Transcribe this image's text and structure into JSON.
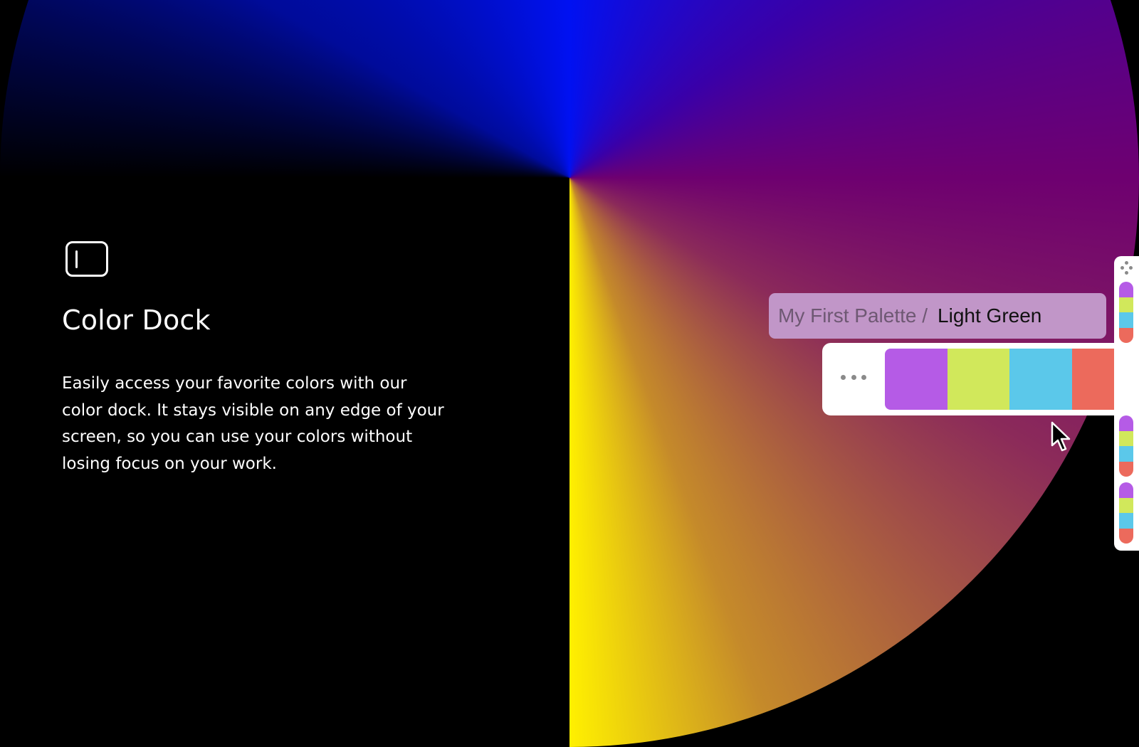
{
  "feature": {
    "icon": "dock-sidebar-icon",
    "title": "Color Dock",
    "description": "Easily access your favorite colors with our color dock. It stays visible on any edge of your screen, so you can use your colors without losing focus on your work."
  },
  "dock": {
    "palette_label": "My First Palette /",
    "color_name": "Light Green",
    "more_icon": "more-horizontal-icon",
    "drag_icon": "drag-handle-icon",
    "swatches": [
      {
        "name": "purple",
        "hex": "#b55be6"
      },
      {
        "name": "light-green",
        "hex": "#d1e85b"
      },
      {
        "name": "blue",
        "hex": "#5bc8ea"
      },
      {
        "name": "red",
        "hex": "#ec6a5c"
      }
    ]
  },
  "colors": {
    "name_bar_bg": "#c196c8",
    "dock_bg": "#ffffff"
  }
}
